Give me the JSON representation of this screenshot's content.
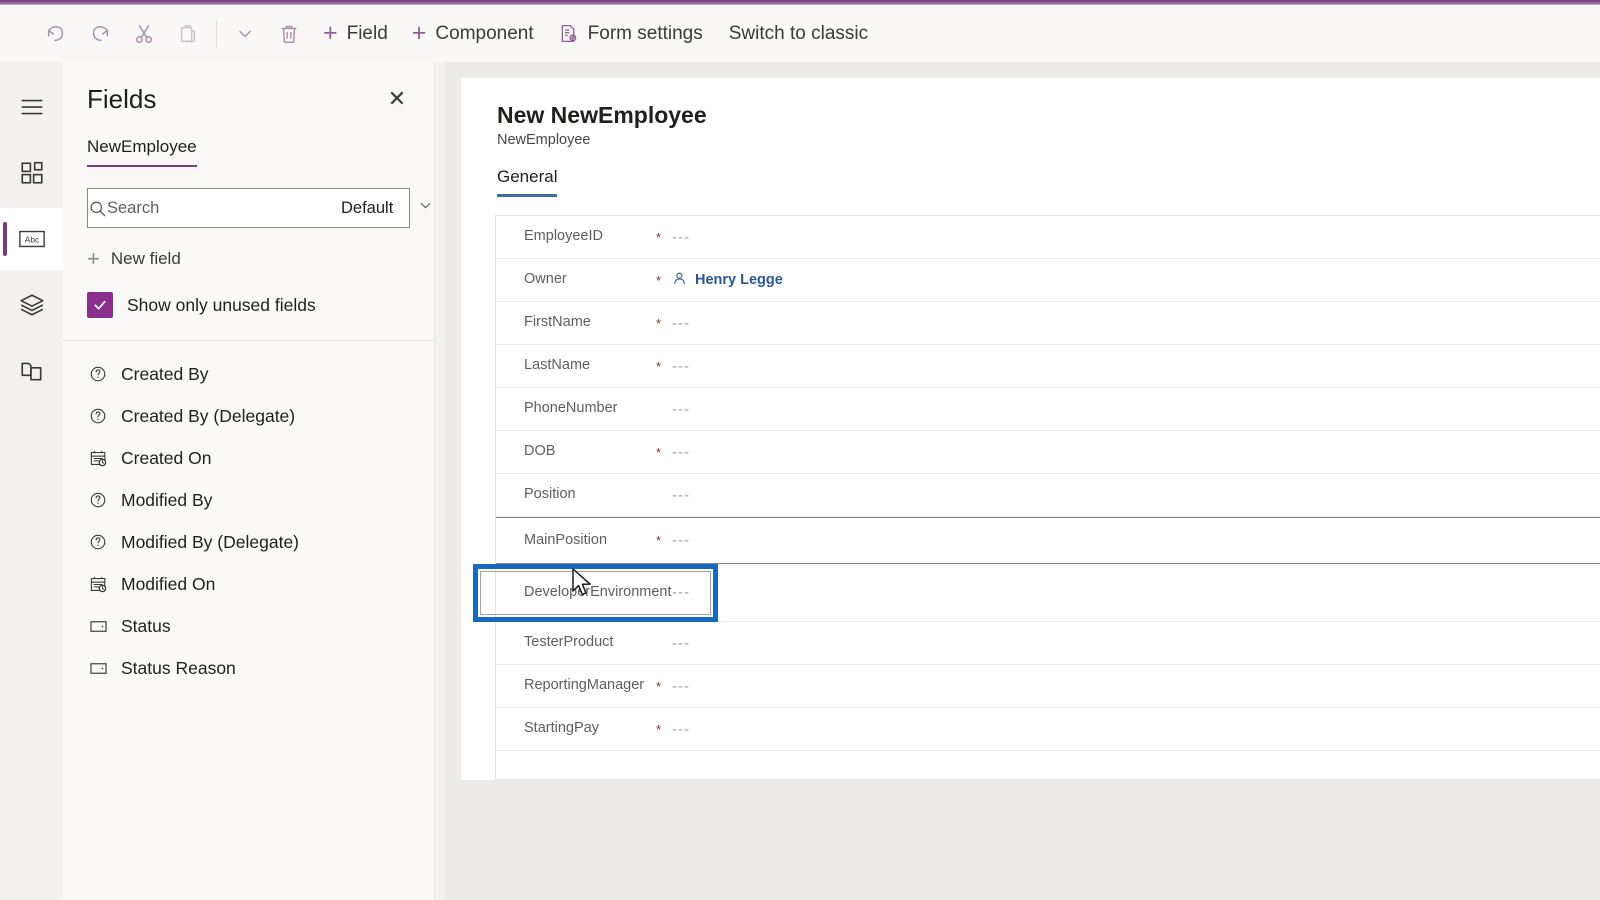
{
  "toolbar": {
    "icons": [
      {
        "name": "undo-icon",
        "label": "Undo",
        "disabled": false
      },
      {
        "name": "redo-icon",
        "label": "Redo",
        "disabled": false
      },
      {
        "name": "cut-icon",
        "label": "Cut",
        "disabled": false
      },
      {
        "name": "paste-icon",
        "label": "Paste",
        "disabled": true
      },
      {
        "name": "chevron-down-icon",
        "label": "More",
        "disabled": false
      },
      {
        "name": "delete-icon",
        "label": "Delete",
        "disabled": false
      }
    ],
    "field_label": "Field",
    "component_label": "Component",
    "form_settings_label": "Form settings",
    "switch_classic_label": "Switch to classic"
  },
  "rail": {
    "items": [
      {
        "name": "menu-icon",
        "label": "Menu"
      },
      {
        "name": "components-icon",
        "label": "Components"
      },
      {
        "name": "fields-icon",
        "label": "Fields"
      },
      {
        "name": "layers-icon",
        "label": "Tree view"
      },
      {
        "name": "pages-icon",
        "label": "Related"
      }
    ],
    "active_index": 2
  },
  "panel": {
    "title": "Fields",
    "close_label": "✕",
    "entity_tab": "NewEmployee",
    "search_placeholder": "Search",
    "search_value": "",
    "filter_selected": "Default",
    "new_field_label": "New field",
    "show_unused_label": "Show only unused fields",
    "show_unused_checked": true,
    "fields": [
      {
        "label": "Created By",
        "icon": "lookup-icon"
      },
      {
        "label": "Created By (Delegate)",
        "icon": "lookup-icon"
      },
      {
        "label": "Created On",
        "icon": "datetime-icon"
      },
      {
        "label": "Modified By",
        "icon": "lookup-icon"
      },
      {
        "label": "Modified By (Delegate)",
        "icon": "lookup-icon"
      },
      {
        "label": "Modified On",
        "icon": "datetime-icon"
      },
      {
        "label": "Status",
        "icon": "choice-icon"
      },
      {
        "label": "Status Reason",
        "icon": "choice-icon"
      }
    ]
  },
  "form": {
    "title": "New NewEmployee",
    "subtitle": "NewEmployee",
    "tab_label": "General",
    "empty_value": "---",
    "rows": [
      {
        "label": "EmployeeID",
        "required": true,
        "value": "---",
        "type": "text"
      },
      {
        "label": "Owner",
        "required": true,
        "value": "Henry Legge",
        "type": "person"
      },
      {
        "label": "FirstName",
        "required": true,
        "value": "---",
        "type": "text"
      },
      {
        "label": "LastName",
        "required": true,
        "value": "---",
        "type": "text"
      },
      {
        "label": "PhoneNumber",
        "required": false,
        "value": "---",
        "type": "text"
      },
      {
        "label": "DOB",
        "required": true,
        "value": "---",
        "type": "text"
      },
      {
        "label": "Position",
        "required": false,
        "value": "---",
        "type": "text"
      },
      {
        "label": "MainPosition",
        "required": true,
        "value": "---",
        "type": "text",
        "selected": true
      },
      {
        "label": "DeveloperEnvironment",
        "required": false,
        "value": "---",
        "type": "text",
        "tall": true
      },
      {
        "label": "TesterProduct",
        "required": false,
        "value": "---",
        "type": "text"
      },
      {
        "label": "ReportingManager",
        "required": true,
        "value": "---",
        "type": "text"
      },
      {
        "label": "StartingPay",
        "required": true,
        "value": "---",
        "type": "text"
      }
    ]
  },
  "colors": {
    "accent_purple": "#7a3b7e",
    "checkbox_purple": "#8a2f8d",
    "selection_blue": "#1668c1",
    "tab_underline_blue": "#3b6ea5",
    "link_blue": "#2b579a",
    "required_red": "#a4262c"
  }
}
